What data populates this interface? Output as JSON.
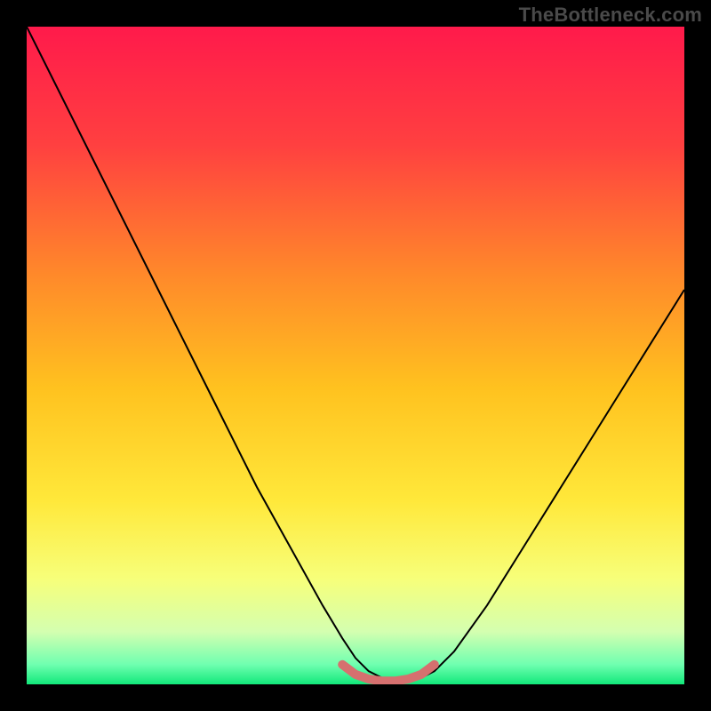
{
  "watermark": "TheBottleneck.com",
  "chart_data": {
    "type": "line",
    "title": "",
    "xlabel": "",
    "ylabel": "",
    "xlim": [
      0,
      100
    ],
    "ylim": [
      0,
      100
    ],
    "grid": false,
    "legend": false,
    "gradient_stops": [
      {
        "offset": 0,
        "color": "#ff1a4b"
      },
      {
        "offset": 18,
        "color": "#ff4040"
      },
      {
        "offset": 38,
        "color": "#ff8a2a"
      },
      {
        "offset": 55,
        "color": "#ffc21f"
      },
      {
        "offset": 72,
        "color": "#ffe83a"
      },
      {
        "offset": 84,
        "color": "#f7ff7a"
      },
      {
        "offset": 92,
        "color": "#d4ffb0"
      },
      {
        "offset": 97,
        "color": "#6fffb0"
      },
      {
        "offset": 100,
        "color": "#12e87a"
      }
    ],
    "series": [
      {
        "name": "bottleneck-curve",
        "stroke": "#000000",
        "stroke_width": 2,
        "x": [
          0,
          5,
          10,
          15,
          20,
          25,
          30,
          35,
          40,
          45,
          48,
          50,
          52,
          54,
          56,
          58,
          60,
          62,
          65,
          70,
          75,
          80,
          85,
          90,
          95,
          100
        ],
        "y": [
          100,
          90,
          80,
          70,
          60,
          50,
          40,
          30,
          21,
          12,
          7,
          4,
          2,
          1,
          0.5,
          0.5,
          1,
          2,
          5,
          12,
          20,
          28,
          36,
          44,
          52,
          60
        ]
      },
      {
        "name": "optimal-band",
        "stroke": "#d6706f",
        "stroke_width": 10,
        "linecap": "round",
        "x": [
          48,
          50,
          52,
          54,
          56,
          58,
          60,
          62
        ],
        "y": [
          3,
          1.5,
          0.8,
          0.5,
          0.5,
          0.8,
          1.5,
          3
        ]
      }
    ]
  }
}
